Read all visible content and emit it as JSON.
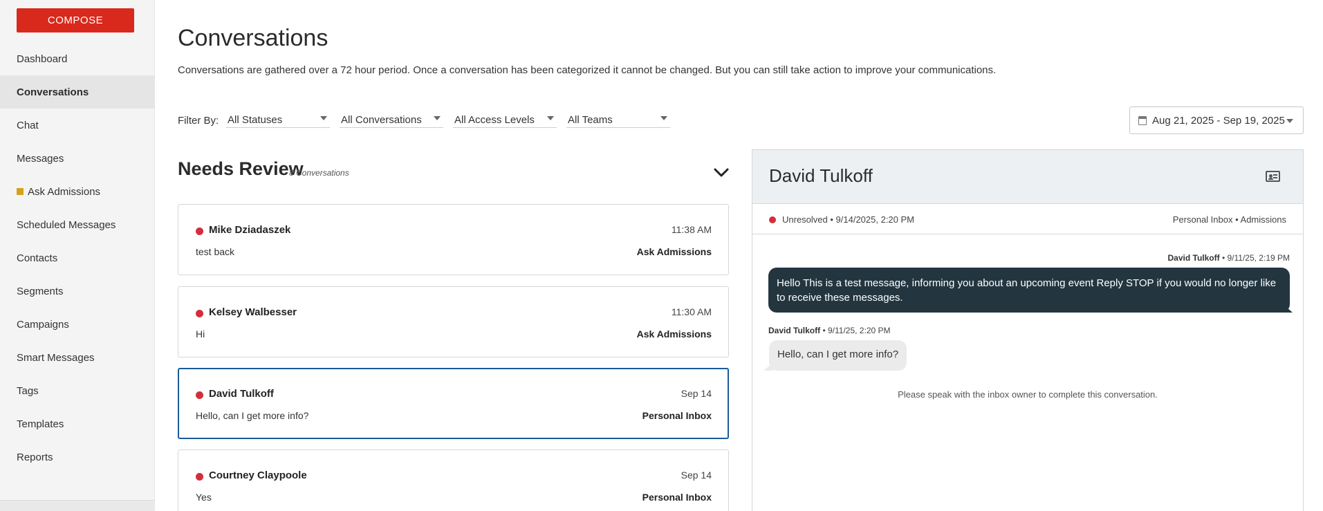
{
  "sidebar": {
    "compose_label": "COMPOSE",
    "items": [
      {
        "label": "Dashboard"
      },
      {
        "label": "Conversations"
      },
      {
        "label": "Chat"
      },
      {
        "label": "Messages"
      },
      {
        "label": "Ask Admissions"
      },
      {
        "label": "Scheduled Messages"
      },
      {
        "label": "Contacts"
      },
      {
        "label": "Segments"
      },
      {
        "label": "Campaigns"
      },
      {
        "label": "Smart Messages"
      },
      {
        "label": "Tags"
      },
      {
        "label": "Templates"
      },
      {
        "label": "Reports"
      }
    ],
    "active_item": "Conversations",
    "ask_admissions_marker_color": "#d4a21a"
  },
  "header": {
    "title": "Conversations",
    "subtitle": "Conversations are gathered over a 72 hour period. Once a conversation has been categorized it cannot be changed. But you can still take action to improve your communications."
  },
  "filters": {
    "label": "Filter By:",
    "status": "All Statuses",
    "conversations": "All Conversations",
    "access": "All Access Levels",
    "teams": "All Teams",
    "date_range": "Aug 21, 2025 - Sep 19, 2025"
  },
  "review": {
    "title": "Needs Review",
    "count": "8 Conversations",
    "cards": [
      {
        "name": "Mike Dziadaszek",
        "time": "11:38 AM",
        "message": "test back",
        "inbox": "Ask Admissions"
      },
      {
        "name": "Kelsey Walbesser",
        "time": "11:30 AM",
        "message": "Hi",
        "inbox": "Ask Admissions"
      },
      {
        "name": "David Tulkoff",
        "time": "Sep 14",
        "message": "Hello, can I get more info?",
        "inbox": "Personal Inbox"
      },
      {
        "name": "Courtney Claypoole",
        "time": "Sep 14",
        "message": "Yes",
        "inbox": "Personal Inbox"
      }
    ]
  },
  "detail": {
    "name": "David Tulkoff",
    "status": "Unresolved • 9/14/2025, 2:20 PM",
    "inbox_info": "Personal Inbox • Admissions",
    "outgoing": {
      "sender": "David Tulkoff",
      "timestamp": " • 9/11/25, 2:19 PM",
      "text": "Hello This is a test message, informing you about an upcoming event Reply STOP if you would no longer like to receive these messages."
    },
    "incoming": {
      "sender": "David Tulkoff",
      "timestamp": " • 9/11/25, 2:20 PM",
      "text": "Hello, can I get more info?"
    },
    "note": "Please speak with the inbox owner to complete this conversation."
  },
  "colors": {
    "compose": "#d9291c",
    "unread_dot": "#d32f3a",
    "selected_border": "#1a5a9a",
    "outgoing_bubble": "#233640"
  }
}
